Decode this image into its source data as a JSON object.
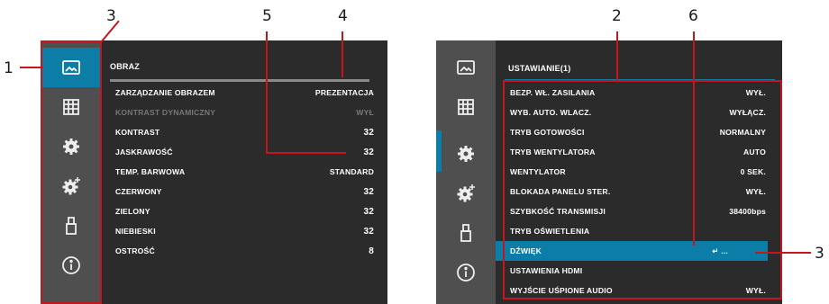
{
  "callouts": [
    "1",
    "3",
    "5",
    "4",
    "2",
    "6",
    "3"
  ],
  "sidebar_icons": [
    "image-icon",
    "grid-icon",
    "gear-icon",
    "gear-plus-icon",
    "usb-icon",
    "info-icon"
  ],
  "left": {
    "title": "OBRAZ",
    "rows": [
      {
        "label": "ZARZĄDZANIE OBRAZEM",
        "value": "PREZENTACJA"
      },
      {
        "label": "KONTRAST DYNAMICZNY",
        "value": "WYŁ"
      },
      {
        "label": "KONTRAST",
        "value": "32"
      },
      {
        "label": "JASKRAWOŚĆ",
        "value": "32"
      },
      {
        "label": "TEMP. BARWOWA",
        "value": "STANDARD"
      },
      {
        "label": "CZERWONY",
        "value": "32"
      },
      {
        "label": "ZIELONY",
        "value": "32"
      },
      {
        "label": "NIEBIESKI",
        "value": "32"
      },
      {
        "label": "OSTROŚĆ",
        "value": "8"
      }
    ]
  },
  "right": {
    "title": "USTAWIANIE(1)",
    "rows": [
      {
        "label": "BEZP. WŁ. ZASILANIA",
        "value": "WYŁ."
      },
      {
        "label": "WYB. AUTO. WLACZ.",
        "value": "WYŁĄCZ."
      },
      {
        "label": "TRYB GOTOWOŚCI",
        "value": "NORMALNY"
      },
      {
        "label": "TRYB WENTYLATORA",
        "value": "AUTO"
      },
      {
        "label": "WENTYLATOR",
        "value": "0 SEK."
      },
      {
        "label": "BLOKADA PANELU STER.",
        "value": "WYŁ."
      },
      {
        "label": "SZYBKOŚĆ TRANSMISJI",
        "value": "38400bps"
      },
      {
        "label": "TRYB OŚWIETLENIA",
        "value": ""
      },
      {
        "label": "DŹWIĘK",
        "value": "↵  ..."
      },
      {
        "label": "USTAWIENIA HDMI",
        "value": ""
      },
      {
        "label": "WYJŚCIE UŚPIONE AUDIO",
        "value": "WYŁ."
      }
    ]
  },
  "colors": {
    "accent": "#0b7da6",
    "annotation": "#c4161c",
    "panel": "#2b2b2b",
    "sidebar": "#4f4f4f"
  }
}
